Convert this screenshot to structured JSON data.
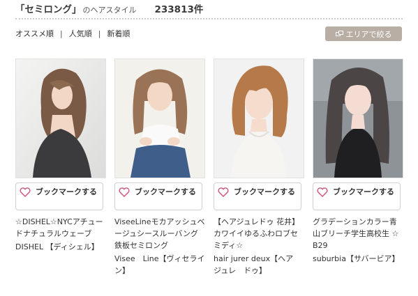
{
  "header": {
    "title": "「セミロング」",
    "suffix": "のヘアスタイル",
    "count": "233813件"
  },
  "sort": {
    "items": [
      "オススメ順",
      "人気順",
      "新着順"
    ],
    "separator": "|"
  },
  "area_button": {
    "label": "エリアで絞る",
    "icon": "filter-icon"
  },
  "colors": {
    "accent": "#b9aea4",
    "heart": "#d0527a"
  },
  "cards": [
    {
      "bookmark_label": "ブックマークする",
      "title": "☆DISHEL☆NYCアチュードナチュラルウェーブ",
      "salon": "DISHEL 【ディシェル】"
    },
    {
      "bookmark_label": "ブックマークする",
      "title": "ViseeLineモカアッシュベージュシースルーバング鉄板セミロング",
      "salon": "Visee　Line【ヴィセライン】"
    },
    {
      "bookmark_label": "ブックマークする",
      "title": "【ヘアジュレドゥ 花井】 カワイイゆるふわロブセミディ☆",
      "salon": "hair jurer deux【ヘア　ジュレ　ドゥ】"
    },
    {
      "bookmark_label": "ブックマークする",
      "title": "グラデーションカラー青山ブリーチ学生高校生 ☆B29",
      "salon": "suburbia【サバービア】"
    }
  ]
}
